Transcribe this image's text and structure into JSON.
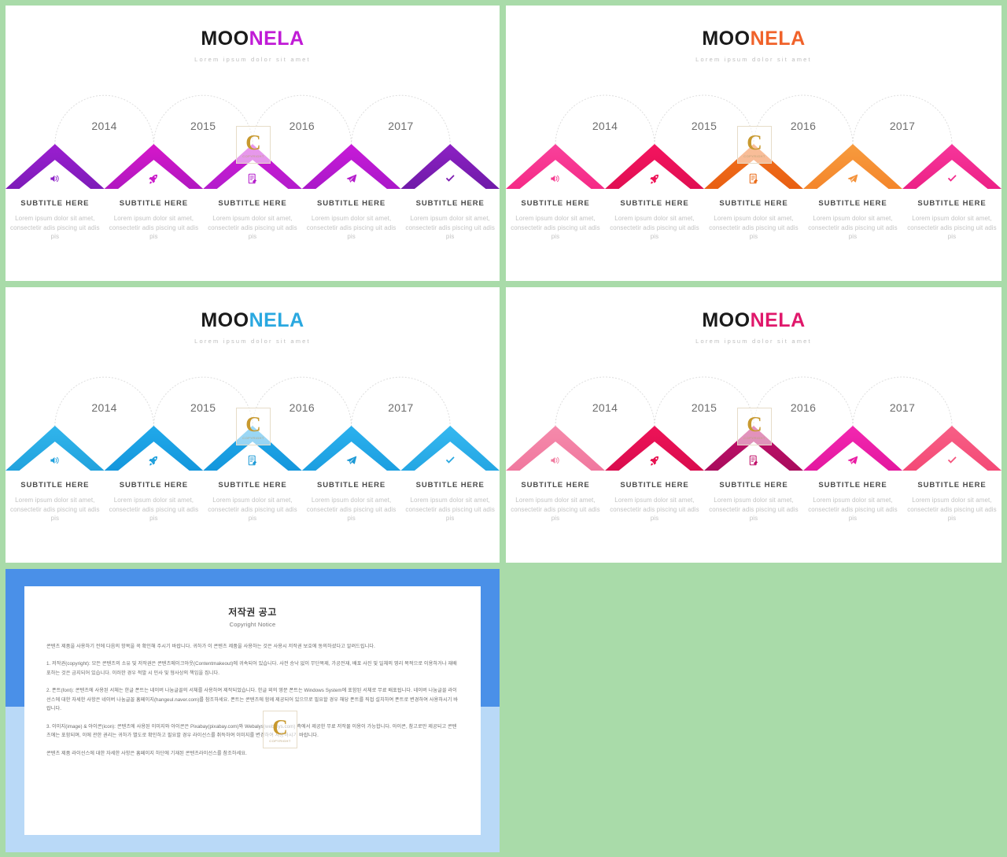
{
  "background_color": "#a9dba9",
  "brand": {
    "name_dark": "MOO",
    "name_accent": "NELA",
    "tagline": "Lorem ipsum dolor sit amet"
  },
  "timeline": {
    "years": [
      "2014",
      "2015",
      "2016",
      "2017"
    ],
    "icons": [
      "speaker-icon",
      "rocket-icon",
      "note-icon",
      "paper-plane-icon",
      "check-icon"
    ]
  },
  "caption": {
    "title": "SUBTITLE HERE",
    "body": "Lorem ipsum dolor sit amet, consectetir adis piscing uit adis pis"
  },
  "captions": [
    {
      "title": "SUBTITLE HERE",
      "body": "Lorem ipsum dolor sit amet, consectetir adis piscing uit adis pis"
    },
    {
      "title": "SUBTITLE HERE",
      "body": "Lorem ipsum dolor sit amet, consectetir adis piscing uit adis pis"
    },
    {
      "title": "SUBTITLE HERE",
      "body": "Lorem ipsum dolor sit amet, consectetir adis piscing uit adis pis"
    },
    {
      "title": "SUBTITLE HERE",
      "body": "Lorem ipsum dolor sit amet, consectetir adis piscing uit adis pis"
    },
    {
      "title": "SUBTITLE HERE",
      "body": "Lorem ipsum dolor sit amet, consectetir adis piscing uit adis pis"
    }
  ],
  "watermark": {
    "letter": "C",
    "sub": "COPYRIGHT"
  },
  "slides": [
    {
      "id": "slide-purple",
      "accent": "#c01bd6",
      "chevrons": [
        {
          "from": "#9b1fd0",
          "to": "#7d1bb8"
        },
        {
          "from": "#d617c9",
          "to": "#b017c0"
        },
        {
          "from": "#cf1ad4",
          "to": "#b31ccc"
        },
        {
          "from": "#c81ad8",
          "to": "#aa18c9"
        },
        {
          "from": "#8d21c4",
          "to": "#6f1aa8"
        }
      ],
      "icon_colors": [
        "#8b1fc6",
        "#c91ac9",
        "#b41ccb",
        "#b41ccb",
        "#7c1ab0"
      ]
    },
    {
      "id": "slide-orange",
      "accent": "#f0622a",
      "chevrons": [
        {
          "from": "#f9419b",
          "to": "#f52a86"
        },
        {
          "from": "#f4145f",
          "to": "#e00f52"
        },
        {
          "from": "#f2711e",
          "to": "#e85f12"
        },
        {
          "from": "#f79b3e",
          "to": "#f4862b"
        },
        {
          "from": "#f7369b",
          "to": "#ec2186"
        }
      ],
      "icon_colors": [
        "#f5398e",
        "#ee1257",
        "#ea6a16",
        "#f4923a",
        "#f22b8c"
      ]
    },
    {
      "id": "slide-blue",
      "accent": "#2aa8e0",
      "chevrons": [
        {
          "from": "#31b5ec",
          "to": "#21a2dd"
        },
        {
          "from": "#21a9ea",
          "to": "#1496dc"
        },
        {
          "from": "#21a9ea",
          "to": "#1496dc"
        },
        {
          "from": "#2cb1ee",
          "to": "#1b9ee0"
        },
        {
          "from": "#35b8f0",
          "to": "#24a6e3"
        }
      ],
      "icon_colors": [
        "#1fa0dc",
        "#1fa0dc",
        "#1d9ad6",
        "#1d9ad6",
        "#2aa8e0"
      ]
    },
    {
      "id": "slide-pink",
      "accent": "#e0186b",
      "chevrons": [
        {
          "from": "#f58aab",
          "to": "#f0789e"
        },
        {
          "from": "#ee1358",
          "to": "#d90c4d"
        },
        {
          "from": "#c4106c",
          "to": "#a80c5c"
        },
        {
          "from": "#f327b0",
          "to": "#e3189f"
        },
        {
          "from": "#f75f86",
          "to": "#f44a76"
        }
      ],
      "icon_colors": [
        "#f07b9f",
        "#e6104f",
        "#c00f69",
        "#ea1ba3",
        "#f5547d"
      ]
    }
  ],
  "copyright": {
    "title": "저작권 공고",
    "subtitle": "Copyright Notice",
    "paragraphs": [
      "콘텐츠 제품을 사용하기 전에 다음의 항목을 꼭 확인해 주시기 바랍니다. 귀하가 이 콘텐츠 제품을 사용하는 것은 사용시 저작권 보호에 동의하셨다고 알려드립니다.",
      "1. 저작권(copyright): 모든 콘텐츠의 소유 및 저작권은 콘텐츠메이크아웃(Contentmakeout)에 귀속되어 있습니다. 사전 승낙 없이 무단복제, 가공전재, 배포 사진 및 일체의 영리 목적으로 이용하거나 재배포하는 것은 금지되어 있습니다. 이러한 경우 적발 시 민사 및 형사상의 책임을 집니다.",
      "2. 폰트(font): 콘텐츠에 사용된 서체는 한글 폰트는 네이버 나눔글꼴의 서체를 사용하여 제작되었습니다. 한글 외의 영문 폰트는 Windows System에 포함된 서체로 무료 배포됩니다. 네이버 나눔글꼴 라이선스에 대한 자세한 사항은 네이버 나눔글꼴 홈페이지(hangeul.naver.com)를 참조하세요. 폰트는 콘텐츠에 함께 제공되어 있으므로 필요할 경우 해당 폰트를 직접 설치하여 폰트로 변경하여 사용하시기 바랍니다.",
      "3. 이미지(image) & 아이콘(icon): 콘텐츠에 사용된 이미지와 아이콘은 Pixabay(pixabay.com)와 Webalys(webalys.com) 측에서 제공한 무료 저작물 이용이 가능합니다. 아이콘, 참고로만 제공되고 콘텐츠에는 포함되며, 이에 관한 권리는 귀하가 별도로 확인하고 필요할 경우 라이선스를 취득하여 이미지를 변경하여 사용하시기 바랍니다.",
      "콘텐츠 제품 라이선스에 대한 자세한 사항은 홈페이지 하단에 기재된 콘텐츠라이선스를 참조하세요."
    ]
  }
}
